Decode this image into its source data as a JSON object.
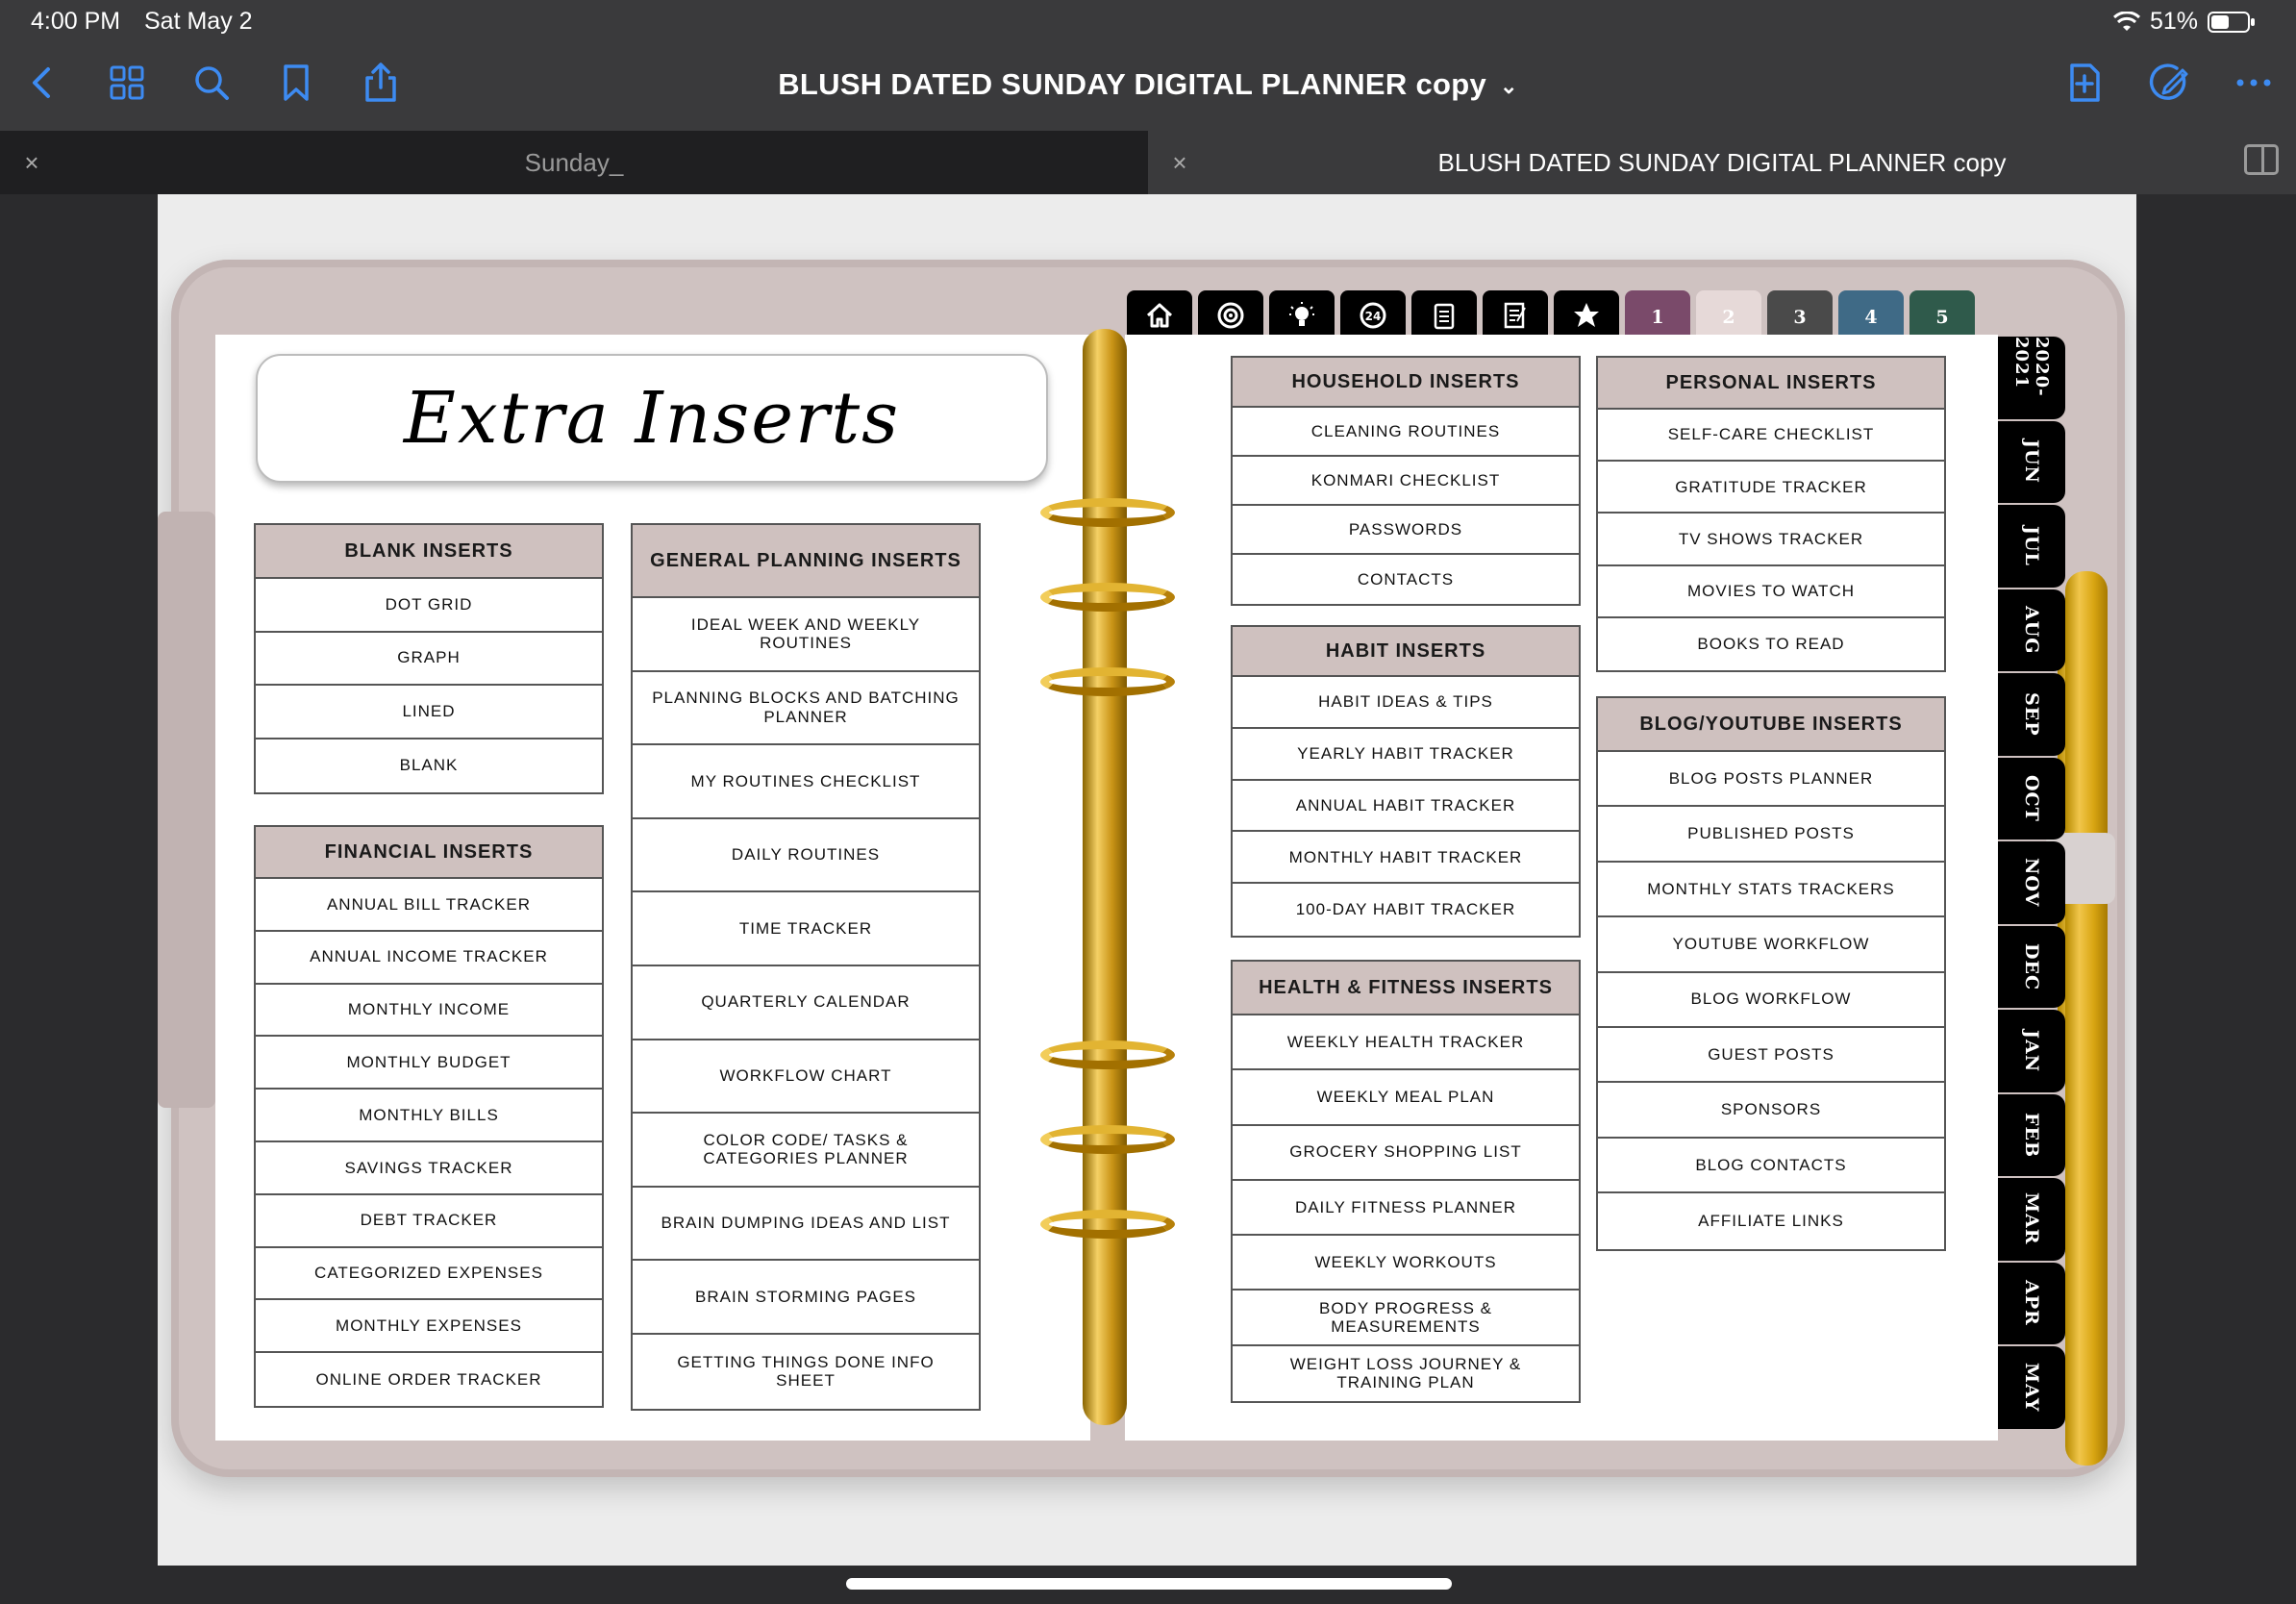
{
  "status": {
    "time": "4:00 PM",
    "date": "Sat May 2",
    "battery": "51%",
    "battery_level": 0.51
  },
  "toolbar": {
    "title": "BLUSH DATED SUNDAY DIGITAL PLANNER copy",
    "icons_left": [
      "back-chevron-icon",
      "thumbnail-grid-icon",
      "search-icon",
      "bookmark-icon",
      "share-icon"
    ],
    "icons_right": [
      "add-page-icon",
      "pencil-circle-icon",
      "more-dots-icon"
    ],
    "accent": "#3d8bf2"
  },
  "tabs": [
    {
      "label": "Sunday_",
      "active": false
    },
    {
      "label": "BLUSH DATED SUNDAY DIGITAL PLANNER copy",
      "active": true
    }
  ],
  "planner": {
    "title": "Extra Inserts",
    "top_tabs": [
      {
        "icon": "home-icon",
        "color": "#000000"
      },
      {
        "icon": "target-icon",
        "color": "#000000"
      },
      {
        "icon": "lightbulb-icon",
        "color": "#000000"
      },
      {
        "icon": "24-hours-icon",
        "color": "#000000"
      },
      {
        "icon": "clipboard-icon",
        "color": "#000000"
      },
      {
        "icon": "notepad-icon",
        "color": "#000000"
      },
      {
        "icon": "star-icon",
        "color": "#000000"
      },
      {
        "label": "1",
        "color": "#7a4a6a"
      },
      {
        "label": "2",
        "color": "#e6d9d8"
      },
      {
        "label": "3",
        "color": "#4a4a4a"
      },
      {
        "label": "4",
        "color": "#3f6a86"
      },
      {
        "label": "5",
        "color": "#2f5a4b"
      }
    ],
    "month_tabs": [
      "2020-2021",
      "JUN",
      "JUL",
      "AUG",
      "SEP",
      "OCT",
      "NOV",
      "DEC",
      "JAN",
      "FEB",
      "MAR",
      "APR",
      "MAY"
    ],
    "sections": {
      "blank": {
        "title": "BLANK INSERTS",
        "items": [
          "DOT GRID",
          "GRAPH",
          "LINED",
          "BLANK"
        ]
      },
      "financial": {
        "title": "FINANCIAL INSERTS",
        "items": [
          "ANNUAL BILL TRACKER",
          "ANNUAL INCOME TRACKER",
          "MONTHLY INCOME",
          "MONTHLY BUDGET",
          "MONTHLY BILLS",
          "SAVINGS TRACKER",
          "DEBT TRACKER",
          "CATEGORIZED EXPENSES",
          "MONTHLY EXPENSES",
          "ONLINE ORDER TRACKER"
        ]
      },
      "general": {
        "title": "GENERAL PLANNING INSERTS",
        "items": [
          "IDEAL WEEK AND WEEKLY ROUTINES",
          "PLANNING BLOCKS AND BATCHING PLANNER",
          "MY ROUTINES CHECKLIST",
          "DAILY ROUTINES",
          "TIME TRACKER",
          "QUARTERLY CALENDAR",
          "WORKFLOW CHART",
          "COLOR CODE/ TASKS & CATEGORIES PLANNER",
          "BRAIN DUMPING IDEAS AND LIST",
          "BRAIN STORMING PAGES",
          "GETTING THINGS DONE INFO SHEET"
        ]
      },
      "household": {
        "title": "HOUSEHOLD INSERTS",
        "items": [
          "CLEANING ROUTINES",
          "KONMARI CHECKLIST",
          "PASSWORDS",
          "CONTACTS"
        ]
      },
      "habit": {
        "title": "HABIT INSERTS",
        "items": [
          "HABIT IDEAS & TIPS",
          "YEARLY HABIT TRACKER",
          "ANNUAL HABIT TRACKER",
          "MONTHLY HABIT TRACKER",
          "100-DAY HABIT TRACKER"
        ]
      },
      "health": {
        "title": "HEALTH & FITNESS INSERTS",
        "items": [
          "WEEKLY HEALTH TRACKER",
          "WEEKLY MEAL PLAN",
          "GROCERY SHOPPING LIST",
          "DAILY FITNESS PLANNER",
          "WEEKLY WORKOUTS",
          "BODY PROGRESS & MEASUREMENTS",
          "WEIGHT LOSS JOURNEY & TRAINING PLAN"
        ]
      },
      "personal": {
        "title": "PERSONAL INSERTS",
        "items": [
          "SELF-CARE CHECKLIST",
          "GRATITUDE TRACKER",
          "TV SHOWS TRACKER",
          "MOVIES TO WATCH",
          "BOOKS TO READ"
        ]
      },
      "blog": {
        "title": "BLOG/YOUTUBE INSERTS",
        "items": [
          "BLOG POSTS PLANNER",
          "PUBLISHED POSTS",
          "MONTHLY STATS TRACKERS",
          "YOUTUBE WORKFLOW",
          "BLOG WORKFLOW",
          "GUEST POSTS",
          "SPONSORS",
          "BLOG CONTACTS",
          "AFFILIATE LINKS"
        ]
      }
    }
  }
}
